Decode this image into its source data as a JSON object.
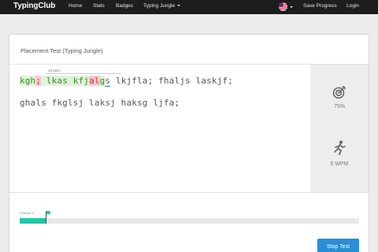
{
  "nav": {
    "brand": "TypingClub",
    "items": [
      "Home",
      "Stats",
      "Badges",
      "Typing Jungle"
    ],
    "save_progress": "Save Progress",
    "login": "Login"
  },
  "test": {
    "title": "Placement Test (Typing Jungle)",
    "hint": "13 wpm",
    "line1_segments": [
      {
        "text": "kgh",
        "state": "ok"
      },
      {
        "text": ";",
        "state": "err"
      },
      {
        "text": " lkas kfj",
        "state": "ok"
      },
      {
        "text": "al",
        "state": "err"
      },
      {
        "text": "g",
        "state": "ok"
      },
      {
        "text": "s",
        "state": "cursor"
      },
      {
        "text": " lkjfla; fhaljs laskjf;",
        "state": "pending"
      }
    ],
    "line2": "ghals fkglsj laksj haksg ljfa;"
  },
  "stats": {
    "accuracy": "75%",
    "accuracy_icon": "target-icon",
    "speed": "5 WPM",
    "speed_icon": "runner-icon"
  },
  "progress": {
    "label": "Lesson 1",
    "fraction": 0.08
  },
  "actions": {
    "stop": "Stop Test"
  },
  "colors": {
    "accent": "#1fc8a8",
    "button": "#2a8ed6",
    "correct_bg": "#dff3d8",
    "error_bg": "#f6c9cf"
  }
}
